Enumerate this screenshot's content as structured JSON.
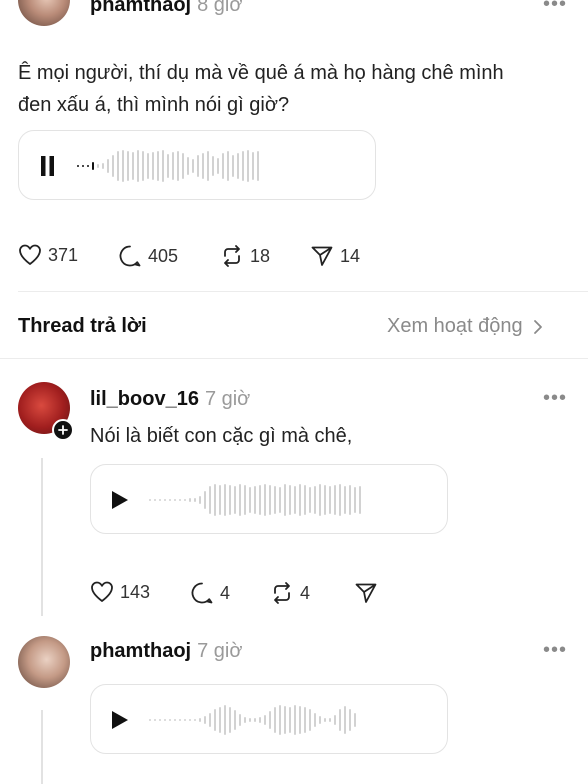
{
  "post": {
    "username": "phamthaoj",
    "time": "8 giờ",
    "text": "Ê mọi người, thí dụ mà về quê á mà họ hàng chê mình đen xấu á, thì mình nói gì giờ?",
    "stats": {
      "likes": "371",
      "comments": "405",
      "reposts": "18",
      "shares": "14"
    },
    "audio_state": "playing"
  },
  "thread_header": {
    "title": "Thread trả lời",
    "activity_link": "Xem hoạt động"
  },
  "replies": [
    {
      "username": "lil_boov_16",
      "time": "7 giờ",
      "text": "Nói là biết con cặc gì mà chê,",
      "stats": {
        "likes": "143",
        "comments": "4",
        "reposts": "4"
      },
      "audio_state": "paused"
    },
    {
      "username": "phamthaoj",
      "time": "7 giờ",
      "audio_state": "paused"
    }
  ],
  "more_label": "•••",
  "colors": {
    "muted": "#9a9a9a",
    "border": "#e3e3e3",
    "wave": "#d2d2d2"
  },
  "icons": [
    "more-icon",
    "pause-icon",
    "play-icon",
    "heart-icon",
    "comment-icon",
    "repost-icon",
    "share-icon",
    "chevron-right-icon",
    "follow-plus-icon"
  ]
}
